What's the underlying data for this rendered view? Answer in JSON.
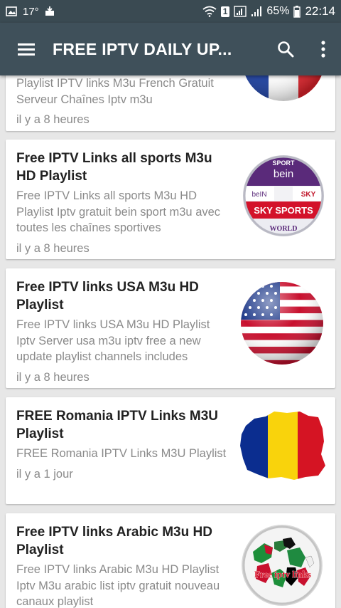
{
  "status_bar": {
    "temperature": "17°",
    "sim_badge": "1",
    "battery": "65%",
    "time": "22:14"
  },
  "app_bar": {
    "title": "FREE IPTV DAILY UP...",
    "icons": [
      "menu-icon",
      "search-icon",
      "more-vert-icon"
    ]
  },
  "colors": {
    "app_bar": "#3f505a",
    "status_bar": "#3a4a52",
    "background": "#e7e7e7"
  },
  "articles": [
    {
      "title": "",
      "description": "Playlist IPTV links M3u French Gratuit Serveur Chaînes Iptv m3u",
      "time": "il y a 8 heures",
      "thumbnail": "france-flag-ball"
    },
    {
      "title": "Free IPTV Links all sports M3u HD Playlist",
      "description": "Free IPTV Links all sports M3u HD Playlist  Iptv gratuit bein sport m3u avec toutes les chaînes sportives",
      "time": "il y a 8 heures",
      "thumbnail": "sports-channels-ball",
      "thumb_labels": {
        "top": "SPORT",
        "brand": "bein",
        "left": "beIN",
        "right": "SKY",
        "bar": "SKY SPORTS",
        "bottom": "WORLD"
      }
    },
    {
      "title": "Free IPTV links USA M3u HD Playlist",
      "description": "Free IPTV links USA M3u HD Playlist Iptv Server usa  m3u iptv free a new update  playlist  channels includes",
      "time": "il y a 8 heures",
      "thumbnail": "usa-flag-ball"
    },
    {
      "title": "FREE Romania IPTV Links M3U Playlist",
      "description": "FREE Romania IPTV Links M3U Playlist",
      "time": "il y a 1 jour",
      "thumbnail": "romania-flag-map"
    },
    {
      "title": "Free IPTV links Arabic M3u HD Playlist",
      "description": "Free IPTV links Arabic M3u HD Playlist Iptv M3u arabic list iptv gratuit nouveau canaux playlist",
      "time": "",
      "thumbnail": "arabic-flags-ball",
      "thumb_label": "Free iptv links"
    }
  ]
}
